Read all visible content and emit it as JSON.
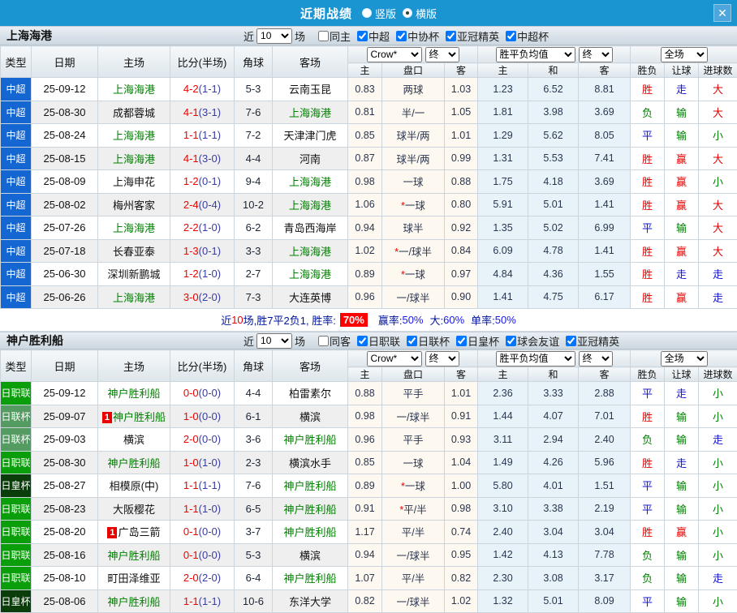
{
  "titlebar": {
    "title": "近期战绩",
    "radios": [
      {
        "label": "竖版",
        "selected": false
      },
      {
        "label": "横版",
        "selected": true
      }
    ],
    "close_glyph": "✕"
  },
  "columns": {
    "main": [
      "类型",
      "日期",
      "主场",
      "比分(半场)",
      "角球",
      "客场"
    ],
    "sub": [
      "主",
      "盘口",
      "客",
      "主",
      "和",
      "客",
      "胜负",
      "让球",
      "进球数"
    ]
  },
  "header_dropdowns": {
    "odds_group": [
      "Crow*",
      "终"
    ],
    "mean_group": [
      "胜平负均值",
      "终"
    ],
    "scope_group": [
      "全场"
    ]
  },
  "type_colors": {
    "中超": "#1467d2",
    "日职联": "#0a9e0a",
    "日联杯": "#539b61",
    "日皇杯": "#0b3d0b"
  },
  "result_colors": {
    "r": "#e60000",
    "b": "#1515cf",
    "g": "#008000"
  },
  "sections": [
    {
      "team": "上海海港",
      "filter": {
        "near": "近",
        "count": "10",
        "unit": "场",
        "same": "同主",
        "same_checked": false,
        "comps": [
          "中超",
          "中协杯",
          "亚冠精英",
          "中超杯"
        ]
      },
      "rows": [
        {
          "type": "中超",
          "date": "25-09-12",
          "home": "上海海港",
          "homeFocus": true,
          "homeBadge": false,
          "score": "4-2",
          "half": "(1-1)",
          "corner": "5-3",
          "away": "云南玉昆",
          "awayFocus": false,
          "o1": "0.83",
          "hcStar": false,
          "hc": "两球",
          "o2": "1.03",
          "m1": "1.23",
          "m2": "6.52",
          "m3": "8.81",
          "res": [
            "胜",
            "r"
          ],
          "let": [
            "走",
            "b"
          ],
          "goal": [
            "大",
            "r"
          ]
        },
        {
          "type": "中超",
          "date": "25-08-30",
          "home": "成都蓉城",
          "homeFocus": false,
          "homeBadge": false,
          "score": "4-1",
          "half": "(3-1)",
          "corner": "7-6",
          "away": "上海海港",
          "awayFocus": true,
          "o1": "0.81",
          "hcStar": false,
          "hc": "半/一",
          "o2": "1.05",
          "m1": "1.81",
          "m2": "3.98",
          "m3": "3.69",
          "res": [
            "负",
            "g"
          ],
          "let": [
            "输",
            "g"
          ],
          "goal": [
            "大",
            "r"
          ]
        },
        {
          "type": "中超",
          "date": "25-08-24",
          "home": "上海海港",
          "homeFocus": true,
          "homeBadge": false,
          "score": "1-1",
          "half": "(1-1)",
          "corner": "7-2",
          "away": "天津津门虎",
          "awayFocus": false,
          "o1": "0.85",
          "hcStar": false,
          "hc": "球半/两",
          "o2": "1.01",
          "m1": "1.29",
          "m2": "5.62",
          "m3": "8.05",
          "res": [
            "平",
            "b"
          ],
          "let": [
            "输",
            "g"
          ],
          "goal": [
            "小",
            "g"
          ]
        },
        {
          "type": "中超",
          "date": "25-08-15",
          "home": "上海海港",
          "homeFocus": true,
          "homeBadge": false,
          "score": "4-1",
          "half": "(3-0)",
          "corner": "4-4",
          "away": "河南",
          "awayFocus": false,
          "o1": "0.87",
          "hcStar": false,
          "hc": "球半/两",
          "o2": "0.99",
          "m1": "1.31",
          "m2": "5.53",
          "m3": "7.41",
          "res": [
            "胜",
            "r"
          ],
          "let": [
            "赢",
            "r"
          ],
          "goal": [
            "大",
            "r"
          ]
        },
        {
          "type": "中超",
          "date": "25-08-09",
          "home": "上海申花",
          "homeFocus": false,
          "homeBadge": false,
          "score": "1-2",
          "half": "(0-1)",
          "corner": "9-4",
          "away": "上海海港",
          "awayFocus": true,
          "o1": "0.98",
          "hcStar": false,
          "hc": "一球",
          "o2": "0.88",
          "m1": "1.75",
          "m2": "4.18",
          "m3": "3.69",
          "res": [
            "胜",
            "r"
          ],
          "let": [
            "赢",
            "r"
          ],
          "goal": [
            "小",
            "g"
          ]
        },
        {
          "type": "中超",
          "date": "25-08-02",
          "home": "梅州客家",
          "homeFocus": false,
          "homeBadge": false,
          "score": "2-4",
          "half": "(0-4)",
          "corner": "10-2",
          "away": "上海海港",
          "awayFocus": true,
          "o1": "1.06",
          "hcStar": true,
          "hc": "一球",
          "o2": "0.80",
          "m1": "5.91",
          "m2": "5.01",
          "m3": "1.41",
          "res": [
            "胜",
            "r"
          ],
          "let": [
            "赢",
            "r"
          ],
          "goal": [
            "大",
            "r"
          ]
        },
        {
          "type": "中超",
          "date": "25-07-26",
          "home": "上海海港",
          "homeFocus": true,
          "homeBadge": false,
          "score": "2-2",
          "half": "(1-0)",
          "corner": "6-2",
          "away": "青岛西海岸",
          "awayFocus": false,
          "o1": "0.94",
          "hcStar": false,
          "hc": "球半",
          "o2": "0.92",
          "m1": "1.35",
          "m2": "5.02",
          "m3": "6.99",
          "res": [
            "平",
            "b"
          ],
          "let": [
            "输",
            "g"
          ],
          "goal": [
            "大",
            "r"
          ]
        },
        {
          "type": "中超",
          "date": "25-07-18",
          "home": "长春亚泰",
          "homeFocus": false,
          "homeBadge": false,
          "score": "1-3",
          "half": "(0-1)",
          "corner": "3-3",
          "away": "上海海港",
          "awayFocus": true,
          "o1": "1.02",
          "hcStar": true,
          "hc": "一/球半",
          "o2": "0.84",
          "m1": "6.09",
          "m2": "4.78",
          "m3": "1.41",
          "res": [
            "胜",
            "r"
          ],
          "let": [
            "赢",
            "r"
          ],
          "goal": [
            "大",
            "r"
          ]
        },
        {
          "type": "中超",
          "date": "25-06-30",
          "home": "深圳新鹏城",
          "homeFocus": false,
          "homeBadge": false,
          "score": "1-2",
          "half": "(1-0)",
          "corner": "2-7",
          "away": "上海海港",
          "awayFocus": true,
          "o1": "0.89",
          "hcStar": true,
          "hc": "一球",
          "o2": "0.97",
          "m1": "4.84",
          "m2": "4.36",
          "m3": "1.55",
          "res": [
            "胜",
            "r"
          ],
          "let": [
            "走",
            "b"
          ],
          "goal": [
            "走",
            "b"
          ]
        },
        {
          "type": "中超",
          "date": "25-06-26",
          "home": "上海海港",
          "homeFocus": true,
          "homeBadge": false,
          "score": "3-0",
          "half": "(2-0)",
          "corner": "7-3",
          "away": "大连英博",
          "awayFocus": false,
          "o1": "0.96",
          "hcStar": false,
          "hc": "一/球半",
          "o2": "0.90",
          "m1": "1.41",
          "m2": "4.75",
          "m3": "6.17",
          "res": [
            "胜",
            "r"
          ],
          "let": [
            "赢",
            "r"
          ],
          "goal": [
            "走",
            "b"
          ]
        }
      ],
      "summary": {
        "near": "近",
        "count": "10",
        "mid": "场,胜7平2负1, 胜率:",
        "rate": "70%",
        "stats": [
          {
            "label": "赢率:",
            "value": "50%"
          },
          {
            "label": "大:",
            "value": "60%"
          },
          {
            "label": "单率:",
            "value": "50%"
          }
        ]
      }
    },
    {
      "team": "神户胜利船",
      "filter": {
        "near": "近",
        "count": "10",
        "unit": "场",
        "same": "同客",
        "same_checked": false,
        "comps": [
          "日职联",
          "日联杯",
          "日皇杯",
          "球会友谊",
          "亚冠精英"
        ]
      },
      "rows": [
        {
          "type": "日职联",
          "date": "25-09-12",
          "home": "神户胜利船",
          "homeFocus": true,
          "homeBadge": false,
          "score": "0-0",
          "half": "(0-0)",
          "corner": "4-4",
          "away": "柏雷素尔",
          "awayFocus": false,
          "o1": "0.88",
          "hcStar": false,
          "hc": "平手",
          "o2": "1.01",
          "m1": "2.36",
          "m2": "3.33",
          "m3": "2.88",
          "res": [
            "平",
            "b"
          ],
          "let": [
            "走",
            "b"
          ],
          "goal": [
            "小",
            "g"
          ]
        },
        {
          "type": "日联杯",
          "date": "25-09-07",
          "home": "神户胜利船",
          "homeFocus": true,
          "homeBadge": true,
          "score": "1-0",
          "half": "(0-0)",
          "corner": "6-1",
          "away": "横滨",
          "awayFocus": false,
          "o1": "0.98",
          "hcStar": false,
          "hc": "一/球半",
          "o2": "0.91",
          "m1": "1.44",
          "m2": "4.07",
          "m3": "7.01",
          "res": [
            "胜",
            "r"
          ],
          "let": [
            "输",
            "g"
          ],
          "goal": [
            "小",
            "g"
          ]
        },
        {
          "type": "日联杯",
          "date": "25-09-03",
          "home": "横滨",
          "homeFocus": false,
          "homeBadge": false,
          "score": "2-0",
          "half": "(0-0)",
          "corner": "3-6",
          "away": "神户胜利船",
          "awayFocus": true,
          "o1": "0.96",
          "hcStar": false,
          "hc": "平手",
          "o2": "0.93",
          "m1": "3.11",
          "m2": "2.94",
          "m3": "2.40",
          "res": [
            "负",
            "g"
          ],
          "let": [
            "输",
            "g"
          ],
          "goal": [
            "走",
            "b"
          ]
        },
        {
          "type": "日职联",
          "date": "25-08-30",
          "home": "神户胜利船",
          "homeFocus": true,
          "homeBadge": false,
          "score": "1-0",
          "half": "(1-0)",
          "corner": "2-3",
          "away": "横滨水手",
          "awayFocus": false,
          "o1": "0.85",
          "hcStar": false,
          "hc": "一球",
          "o2": "1.04",
          "m1": "1.49",
          "m2": "4.26",
          "m3": "5.96",
          "res": [
            "胜",
            "r"
          ],
          "let": [
            "走",
            "b"
          ],
          "goal": [
            "小",
            "g"
          ]
        },
        {
          "type": "日皇杯",
          "date": "25-08-27",
          "home": "相模原(中)",
          "homeFocus": false,
          "homeBadge": false,
          "score": "1-1",
          "half": "(1-1)",
          "corner": "7-6",
          "away": "神户胜利船",
          "awayFocus": true,
          "o1": "0.89",
          "hcStar": true,
          "hc": "一球",
          "o2": "1.00",
          "m1": "5.80",
          "m2": "4.01",
          "m3": "1.51",
          "res": [
            "平",
            "b"
          ],
          "let": [
            "输",
            "g"
          ],
          "goal": [
            "小",
            "g"
          ]
        },
        {
          "type": "日职联",
          "date": "25-08-23",
          "home": "大阪樱花",
          "homeFocus": false,
          "homeBadge": false,
          "score": "1-1",
          "half": "(1-0)",
          "corner": "6-5",
          "away": "神户胜利船",
          "awayFocus": true,
          "o1": "0.91",
          "hcStar": true,
          "hc": "平/半",
          "o2": "0.98",
          "m1": "3.10",
          "m2": "3.38",
          "m3": "2.19",
          "res": [
            "平",
            "b"
          ],
          "let": [
            "输",
            "g"
          ],
          "goal": [
            "小",
            "g"
          ]
        },
        {
          "type": "日职联",
          "date": "25-08-20",
          "home": "广岛三箭",
          "homeFocus": false,
          "homeBadge": true,
          "score": "0-1",
          "half": "(0-0)",
          "corner": "3-7",
          "away": "神户胜利船",
          "awayFocus": true,
          "o1": "1.17",
          "hcStar": false,
          "hc": "平/半",
          "o2": "0.74",
          "m1": "2.40",
          "m2": "3.04",
          "m3": "3.04",
          "res": [
            "胜",
            "r"
          ],
          "let": [
            "赢",
            "r"
          ],
          "goal": [
            "小",
            "g"
          ]
        },
        {
          "type": "日职联",
          "date": "25-08-16",
          "home": "神户胜利船",
          "homeFocus": true,
          "homeBadge": false,
          "score": "0-1",
          "half": "(0-0)",
          "corner": "5-3",
          "away": "横滨",
          "awayFocus": false,
          "o1": "0.94",
          "hcStar": false,
          "hc": "一/球半",
          "o2": "0.95",
          "m1": "1.42",
          "m2": "4.13",
          "m3": "7.78",
          "res": [
            "负",
            "g"
          ],
          "let": [
            "输",
            "g"
          ],
          "goal": [
            "小",
            "g"
          ]
        },
        {
          "type": "日职联",
          "date": "25-08-10",
          "home": "町田泽维亚",
          "homeFocus": false,
          "homeBadge": false,
          "score": "2-0",
          "half": "(2-0)",
          "corner": "6-4",
          "away": "神户胜利船",
          "awayFocus": true,
          "o1": "1.07",
          "hcStar": false,
          "hc": "平/半",
          "o2": "0.82",
          "m1": "2.30",
          "m2": "3.08",
          "m3": "3.17",
          "res": [
            "负",
            "g"
          ],
          "let": [
            "输",
            "g"
          ],
          "goal": [
            "走",
            "b"
          ]
        },
        {
          "type": "日皇杯",
          "date": "25-08-06",
          "home": "神户胜利船",
          "homeFocus": true,
          "homeBadge": false,
          "score": "1-1",
          "half": "(1-1)",
          "corner": "10-6",
          "away": "东洋大学",
          "awayFocus": false,
          "o1": "0.82",
          "hcStar": false,
          "hc": "一/球半",
          "o2": "1.02",
          "m1": "1.32",
          "m2": "5.01",
          "m3": "8.09",
          "res": [
            "平",
            "b"
          ],
          "let": [
            "输",
            "g"
          ],
          "goal": [
            "小",
            "g"
          ]
        }
      ],
      "summary": null
    }
  ]
}
